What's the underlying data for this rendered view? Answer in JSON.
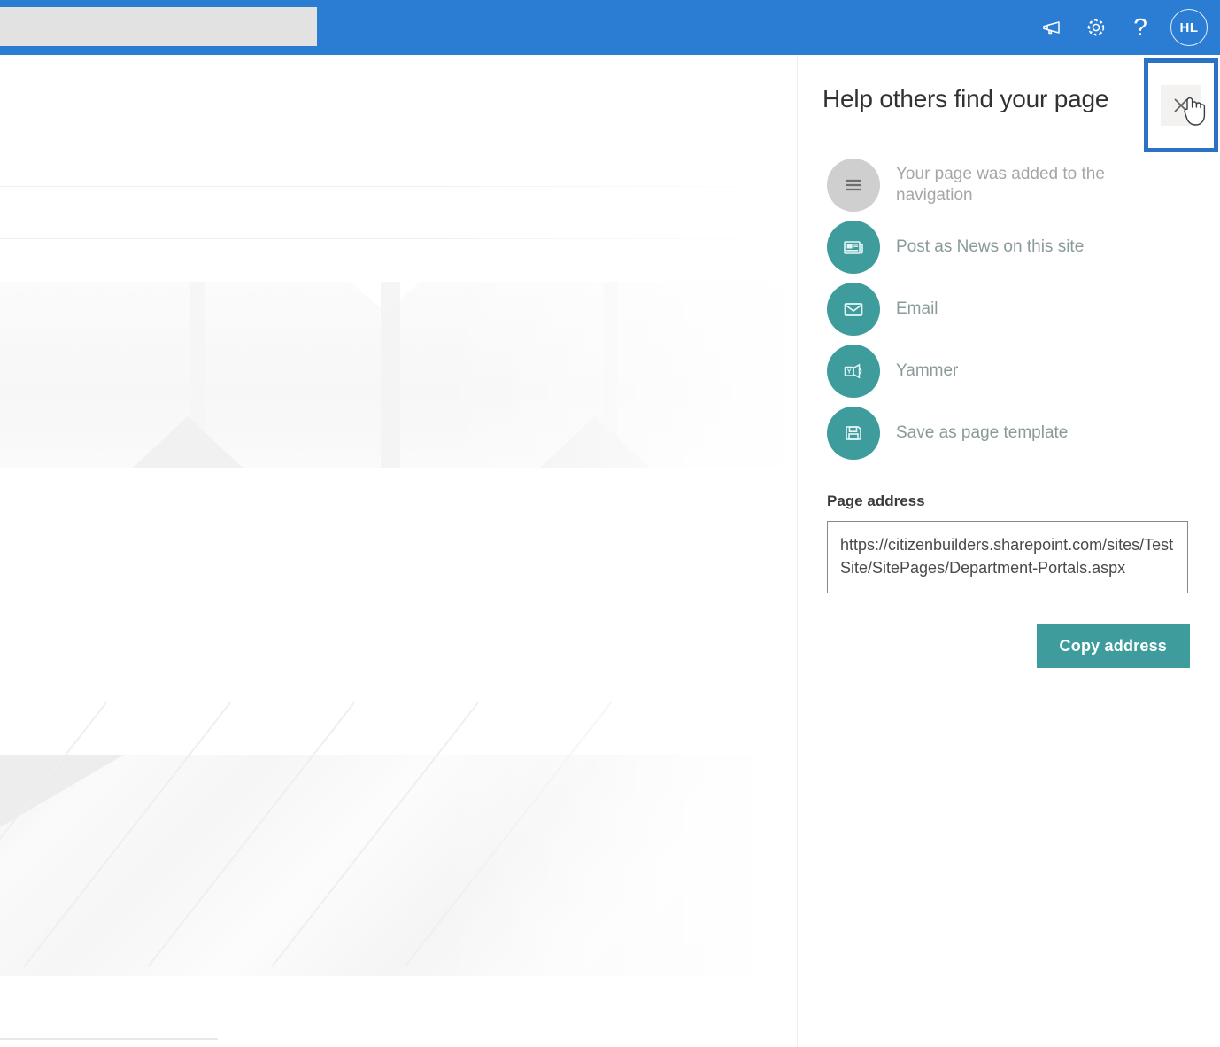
{
  "colors": {
    "suite_bar": "#2b7cd3",
    "accent_teal": "#3f9c9c",
    "highlight_blue": "#2c72c4",
    "link_text": "#8a9a9a",
    "muted_text": "#a6a6a6"
  },
  "suite_bar": {
    "search_value": "",
    "search_placeholder": "",
    "icons": [
      {
        "name": "megaphone-icon",
        "label": ""
      },
      {
        "name": "gear-icon",
        "label": ""
      },
      {
        "name": "help-icon",
        "label": "?"
      }
    ],
    "avatar_initials": "HL"
  },
  "panel": {
    "title": "Help others find your page",
    "close_label": "",
    "actions": [
      {
        "id": "navigation",
        "icon": "hamburger-icon",
        "label": "Your page was added to the navigation",
        "style": "grey"
      },
      {
        "id": "post-news",
        "icon": "news-icon",
        "label": "Post as News on this site",
        "style": "teal"
      },
      {
        "id": "email",
        "icon": "envelope-icon",
        "label": "Email",
        "style": "teal"
      },
      {
        "id": "yammer",
        "icon": "yammer-icon",
        "label": "Yammer",
        "style": "teal"
      },
      {
        "id": "save-template",
        "icon": "floppy-disk-icon",
        "label": "Save as page template",
        "style": "teal"
      }
    ],
    "page_address": {
      "label": "Page address",
      "value": "https://citizenbuilders.sharepoint.com/sites/TestSite/SitePages/Department-Portals.aspx",
      "placeholder": ""
    },
    "copy_button": "Copy address"
  }
}
